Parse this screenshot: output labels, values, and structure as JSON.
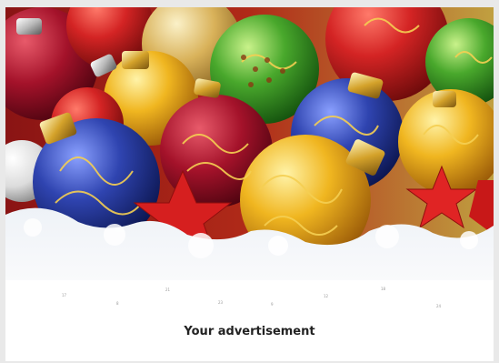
{
  "advertisement": {
    "text": "Your advertisement"
  },
  "calendar_numbers": [
    "17",
    "8",
    "21",
    "23",
    "9",
    "12",
    "18",
    "24"
  ],
  "image": {
    "subject": "christmas-baubles-on-snow",
    "colors": {
      "red": "#c81e1e",
      "gold": "#e6a418",
      "green": "#3f9a2c",
      "blue": "#2d3f9a",
      "snow": "#f7f7f7"
    }
  }
}
